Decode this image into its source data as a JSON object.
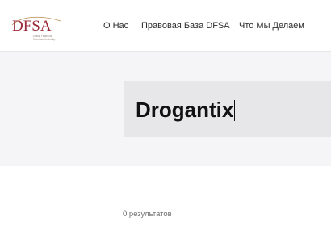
{
  "header": {
    "logo": {
      "mark_text": "DFSA",
      "subtitle_lines": [
        "Dubai Financial",
        "Services Authority"
      ]
    },
    "nav": {
      "about": "О Нас",
      "legal_base": "Правовая База DFSA",
      "what_we_do": "Что Мы Делаем"
    }
  },
  "search": {
    "value": "Drogantix"
  },
  "results": {
    "summary": "0 результатов"
  },
  "colors": {
    "logo_red": "#9c2b3a",
    "logo_gold": "#b88a4a",
    "band_bg": "#f5f5f7",
    "search_bg": "#e7e7e9"
  }
}
